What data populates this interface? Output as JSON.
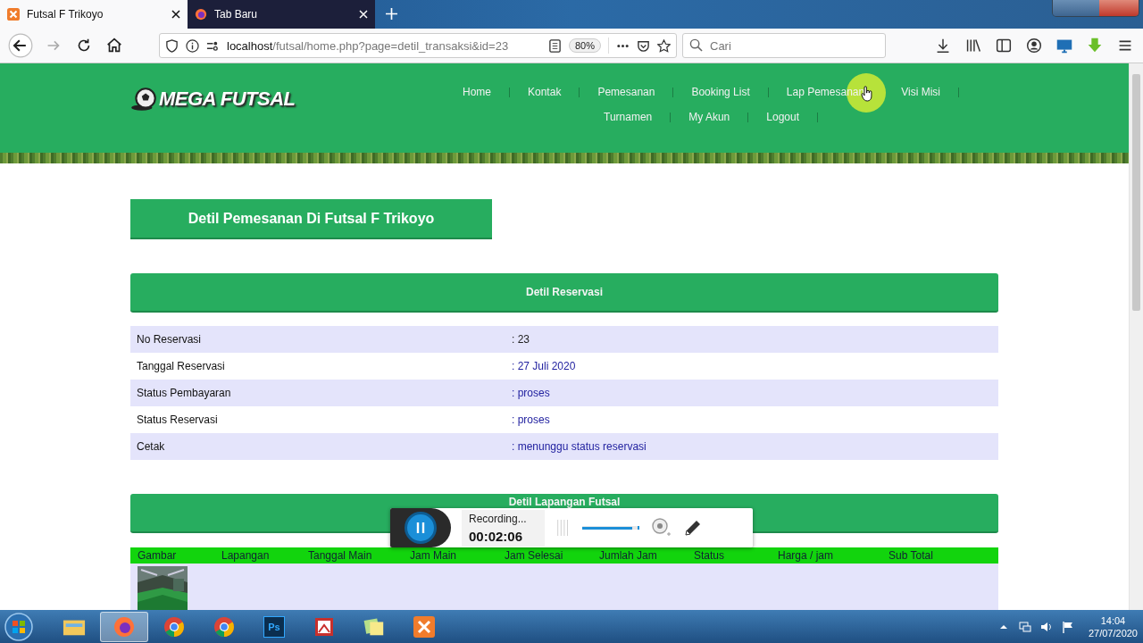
{
  "browser": {
    "tabs": [
      {
        "title": "Futsal F Trikoyo",
        "kind": "xampp",
        "selected": true
      },
      {
        "title": "Tab Baru",
        "kind": "firefox",
        "selected": false
      }
    ],
    "url_host": "localhost",
    "url_path": "/futsal/home.php?page=detil_transaksi&id=23",
    "zoom": "80%",
    "search": {
      "placeholder": "Cari"
    }
  },
  "site": {
    "logo": "MEGA FUTSAL",
    "nav": [
      {
        "label": "Home",
        "hovered": false
      },
      {
        "label": "Kontak",
        "hovered": false
      },
      {
        "label": "Pemesanan",
        "hovered": false
      },
      {
        "label": "Booking List",
        "hovered": false
      },
      {
        "label": "Lap Pemesanan",
        "hovered": true
      },
      {
        "label": "Visi Misi",
        "hovered": false
      },
      {
        "label": "Turnamen",
        "hovered": false
      },
      {
        "label": "My Akun",
        "hovered": false
      },
      {
        "label": "Logout",
        "hovered": false
      }
    ]
  },
  "page_title": "Detil Pemesanan Di Futsal F Trikoyo",
  "reservation": {
    "title": "Detil Reservasi",
    "rows": [
      {
        "label": "No Reservasi",
        "value": ": 23",
        "kind": "plain"
      },
      {
        "label": "Tanggal Reservasi",
        "value": ": 27 Juli 2020",
        "kind": "link"
      },
      {
        "label": "Status Pembayaran",
        "value": ": proses",
        "kind": "link"
      },
      {
        "label": "Status Reservasi",
        "value": ": proses",
        "kind": "link"
      },
      {
        "label": "Cetak",
        "value": ": menunggu status reservasi",
        "kind": "link"
      }
    ]
  },
  "field": {
    "title": "Detil Lapangan Futsal",
    "columns": [
      "Gambar",
      "Lapangan",
      "Tanggal Main",
      "Jam Main",
      "Jam Selesai",
      "Jumlah Jam",
      "Status",
      "Harga / jam",
      "Sub Total"
    ]
  },
  "recorder": {
    "status": "Recording...",
    "time": "00:02:06",
    "level": 0.9
  },
  "taskbar": {
    "apps": [
      {
        "kind": "explorer",
        "selected": false
      },
      {
        "kind": "firefox",
        "selected": true
      },
      {
        "kind": "chrome",
        "selected": false
      },
      {
        "kind": "chrome",
        "selected": false
      },
      {
        "kind": "photoshop",
        "label": "Ps",
        "selected": false
      },
      {
        "kind": "presentation",
        "selected": false
      },
      {
        "kind": "notes",
        "selected": false
      },
      {
        "kind": "xampp",
        "selected": false
      }
    ],
    "time": "14:04",
    "date": "27/07/2020"
  }
}
